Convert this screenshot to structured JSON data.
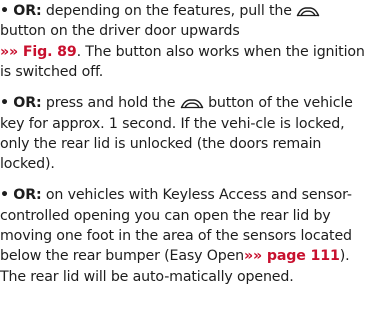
{
  "colors": {
    "text": "#1d1d1d",
    "reference": "#c8102e"
  },
  "icons": {
    "rear_lid": "rear-lid-unlock-icon"
  },
  "paragraphs": [
    {
      "bullet": "•",
      "keyword": "OR:",
      "seg1": " depending on the features, pull the ",
      "seg2": "button on the driver door upwards",
      "ref_arrow": "»»",
      "ref_label": "Fig. 89",
      "seg3": ". The button also works when the ignition is switched off."
    },
    {
      "bullet": "•",
      "keyword": "OR:",
      "seg1": " press and hold the ",
      "seg2": " button of the vehicle key for approx. 1 second. If the vehi-cle is locked, only the rear lid is unlocked (the doors remain locked)."
    },
    {
      "bullet": "•",
      "keyword": "OR:",
      "seg1": " on vehicles with Keyless Access and sensor-controlled opening you can open the rear lid by moving one foot in the area of the sensors located below the rear bumper (Easy Open",
      "ref_arrow": "»»",
      "ref_label": "page 111",
      "seg2": "). The rear lid will be auto-matically opened."
    }
  ]
}
